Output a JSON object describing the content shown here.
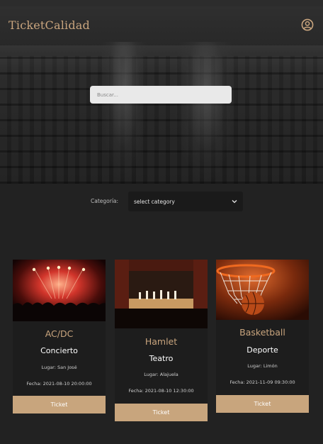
{
  "header": {
    "brand": "TicketCalidad",
    "user_icon": "user-circle-icon"
  },
  "search": {
    "placeholder": "Buscar..."
  },
  "filter": {
    "label": "Categoría:",
    "selected": "select category"
  },
  "events": [
    {
      "title": "AC/DC",
      "category": "Concierto",
      "lugar": "Lugar: San José",
      "fecha": "Fecha: 2021-08-10 20:00:00",
      "button": "Ticket"
    },
    {
      "title": "Hamlet",
      "category": "Teatro",
      "lugar": "Lugar: Alajuela",
      "fecha": "Fecha: 2021-08-10 12:30:00",
      "button": "Ticket"
    },
    {
      "title": "Basketball",
      "category": "Deporte",
      "lugar": "Lugar: Limón",
      "fecha": "Fecha: 2021-11-09 09:30:00",
      "button": "Ticket"
    }
  ],
  "colors": {
    "accent": "#c8a57d",
    "background": "#222222",
    "card": "#1d1d1d"
  }
}
